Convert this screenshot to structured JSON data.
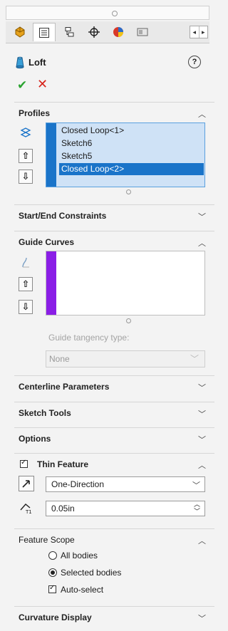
{
  "tabs": [
    {
      "icon": "feature-manager-icon",
      "active": false
    },
    {
      "icon": "property-manager-icon",
      "active": true
    },
    {
      "icon": "configuration-manager-icon",
      "active": false
    },
    {
      "icon": "dimxpert-icon",
      "active": false
    },
    {
      "icon": "display-manager-icon",
      "active": false
    },
    {
      "icon": "more-tabs-icon",
      "active": false
    }
  ],
  "header": {
    "title": "Loft",
    "help_symbol": "?",
    "ok_symbol": "✔",
    "cancel_symbol": "✕"
  },
  "profiles": {
    "label": "Profiles",
    "items": [
      "Closed Loop<1>",
      "Sketch6",
      "Sketch5",
      "Closed Loop<2>"
    ],
    "selected_index": 3
  },
  "start_end": {
    "label": "Start/End Constraints"
  },
  "guide_curves": {
    "label": "Guide Curves",
    "tangency_label": "Guide tangency type:",
    "tangency_value": "None"
  },
  "centerline": {
    "label": "Centerline Parameters"
  },
  "sketch_tools": {
    "label": "Sketch Tools"
  },
  "options": {
    "label": "Options"
  },
  "thin_feature": {
    "label": "Thin Feature",
    "checked": true,
    "direction": "One-Direction",
    "thickness": "0.05in"
  },
  "feature_scope": {
    "label": "Feature Scope",
    "all_bodies": "All bodies",
    "selected_bodies": "Selected bodies",
    "auto_select": "Auto-select",
    "selected": "Selected bodies",
    "auto_select_checked": true
  },
  "curvature": {
    "label": "Curvature Display"
  },
  "colors": {
    "accent_blue": "#1a74c9",
    "guide_curve_color": "#8a1ee6",
    "ok_green": "#2aa330",
    "cancel_red": "#d7251c"
  }
}
